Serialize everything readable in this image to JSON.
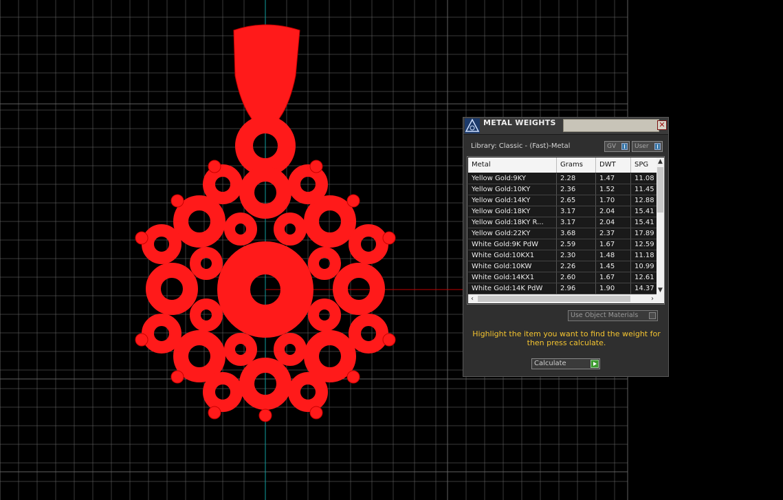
{
  "dialog": {
    "title": "METAL WEIGHTS",
    "close_symbol": "✕",
    "library_label": "Library: Classic - (Fast)-Metal",
    "gv_toggle": "GV",
    "user_toggle": "User",
    "table": {
      "headers": [
        "Metal",
        "Grams",
        "DWT",
        "SPG"
      ],
      "rows": [
        [
          "Yellow Gold:9KY",
          "2.28",
          "1.47",
          "11.08"
        ],
        [
          "Yellow Gold:10KY",
          "2.36",
          "1.52",
          "11.45"
        ],
        [
          "Yellow Gold:14KY",
          "2.65",
          "1.70",
          "12.88"
        ],
        [
          "Yellow Gold:18KY",
          "3.17",
          "2.04",
          "15.41"
        ],
        [
          "Yellow Gold:18KY R...",
          "3.17",
          "2.04",
          "15.41"
        ],
        [
          "Yellow Gold:22KY",
          "3.68",
          "2.37",
          "17.89"
        ],
        [
          "White Gold:9K PdW",
          "2.59",
          "1.67",
          "12.59"
        ],
        [
          "White Gold:10KX1",
          "2.30",
          "1.48",
          "11.18"
        ],
        [
          "White Gold:10KW",
          "2.26",
          "1.45",
          "10.99"
        ],
        [
          "White Gold:14KX1",
          "2.60",
          "1.67",
          "12.61"
        ],
        [
          "White Gold:14K PdW",
          "2.96",
          "1.90",
          "14.37"
        ]
      ]
    },
    "use_materials_label": "Use Object Materials",
    "hint_text": "Highlight the item you want to find the weight for then press calculate.",
    "calculate_label": "Calculate"
  },
  "colors": {
    "background": "#000000",
    "grid": "#6a6a6a",
    "model": "#ff1a1a",
    "axis_vertical": "#0fa0a0",
    "axis_horizontal": "#c00000",
    "hint_text": "#f4c430"
  },
  "icons": {
    "app_logo": "triangle-logo-icon",
    "close": "close-icon",
    "toggle": "toggle-knob-icon",
    "calculate": "play-arrow-icon"
  }
}
